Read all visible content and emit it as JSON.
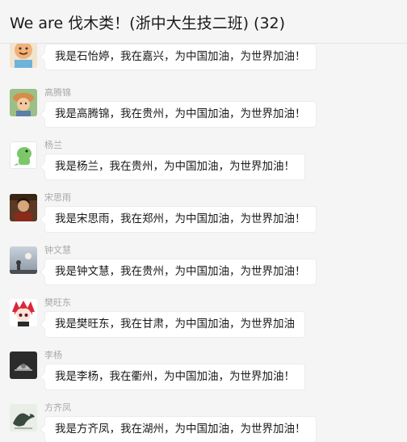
{
  "header": {
    "title": "We are 伐木类！(浙中大生技二班) (32)"
  },
  "messages": [
    {
      "sender": "",
      "text": "我是石怡婷，我在嘉兴，为中国加油，为世界加油！",
      "avatar": "smiling-bear-avatar"
    },
    {
      "sender": "高腾锦",
      "text": "我是高腾锦，我在贵州，为中国加油，为世界加油！",
      "avatar": "kid-with-hat-avatar"
    },
    {
      "sender": "杨兰",
      "text": "我是杨兰，我在贵州，为中国加油，为世界加油！",
      "avatar": "green-dino-avatar"
    },
    {
      "sender": "宋思雨",
      "text": "我是宋思雨，我在郑州，为中国加油，为世界加油！",
      "avatar": "painting-portrait-avatar"
    },
    {
      "sender": "钟文慧",
      "text": "我是钟文慧，我在贵州，为中国加油，为世界加油！",
      "avatar": "sunset-silhouette-avatar"
    },
    {
      "sender": "樊旺东",
      "text": "我是樊旺东，我在甘肃，为中国加油，为世界加油",
      "avatar": "red-hair-anime-avatar"
    },
    {
      "sender": "李杨",
      "text": "我是李杨，我在衢州，为中国加油，为世界加油！",
      "avatar": "dark-sketch-avatar"
    },
    {
      "sender": "方齐凤",
      "text": "我是方齐凤，我在湖州，为中国加油，为世界加油！",
      "avatar": "bird-sketch-avatar"
    }
  ]
}
